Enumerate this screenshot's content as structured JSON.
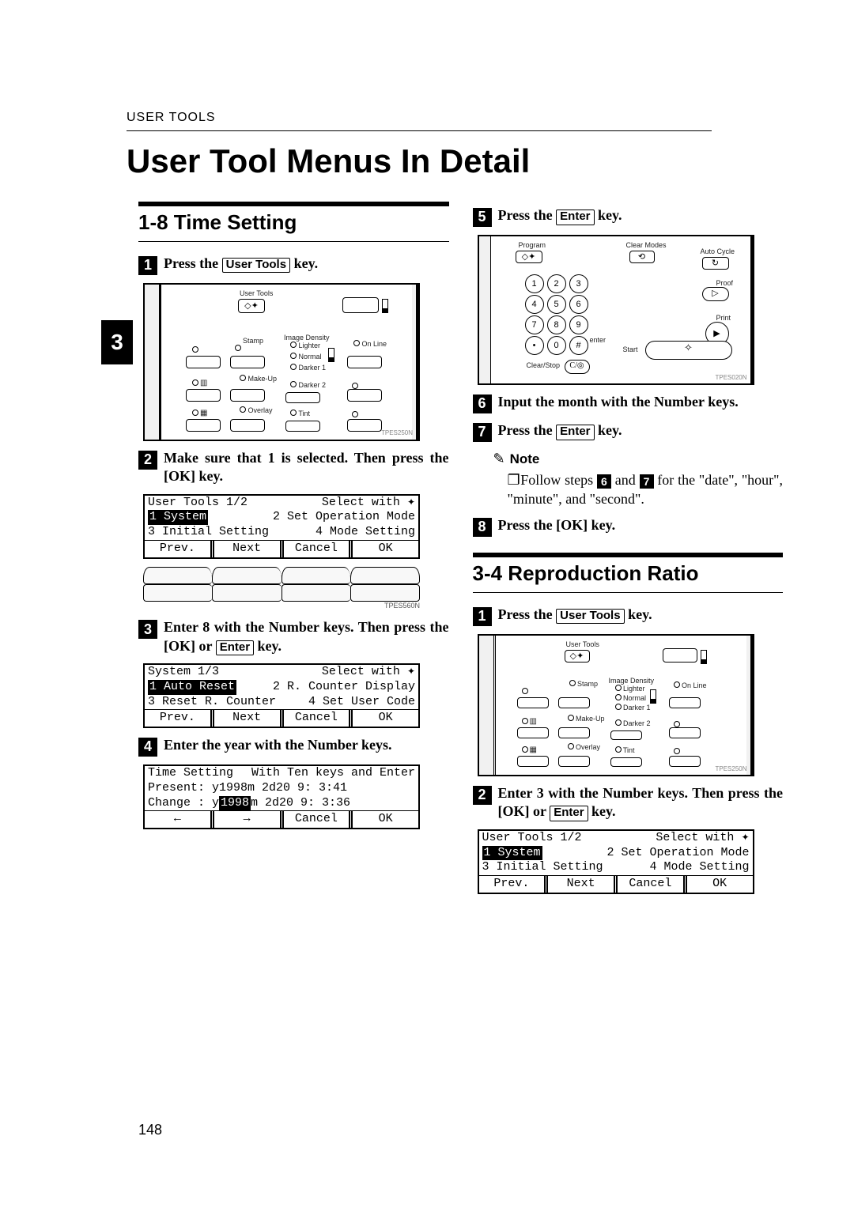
{
  "header": {
    "running_head": "USER TOOLS"
  },
  "page_title": "User Tool Menus In Detail",
  "chapter_tab": "3",
  "page_number": "148",
  "keys": {
    "user_tools": "User Tools",
    "enter": "Enter",
    "ok": "OK"
  },
  "sections": {
    "time_setting": {
      "title": "1-8 Time Setting",
      "steps": {
        "s1": {
          "num": "1",
          "pre": "Press the ",
          "post": " key."
        },
        "s2": {
          "num": "2",
          "text_a": "Make sure that 1 is selected. Then press the [",
          "text_b": "] key."
        },
        "s3": {
          "num": "3",
          "text_a": "Enter 8 with the Number keys. Then press the [",
          "text_b": "] or ",
          "text_c": " key."
        },
        "s4": {
          "num": "4",
          "text": "Enter the year with the Number keys."
        },
        "s5": {
          "num": "5",
          "pre": "Press the ",
          "post": " key."
        },
        "s6": {
          "num": "6",
          "text": "Input the month with the Number keys."
        },
        "s7": {
          "num": "7",
          "pre": "Press the ",
          "post": " key."
        },
        "s8": {
          "num": "8",
          "text_a": "Press the [",
          "text_b": "] key."
        }
      },
      "note": {
        "label": "Note",
        "body_a": "Follow steps ",
        "ref1": "6",
        "body_b": " and ",
        "ref2": "7",
        "body_c": " for the \"date\", \"hour\", \"minute\", and \"second\"."
      }
    },
    "repro_ratio": {
      "title": "3-4 Reproduction Ratio",
      "steps": {
        "s1": {
          "num": "1",
          "pre": "Press the ",
          "post": " key."
        },
        "s2": {
          "num": "2",
          "text_a": "Enter 3 with the Number keys. Then press the [",
          "text_b": "] or ",
          "text_c": " key."
        }
      }
    }
  },
  "lcd": {
    "user_tools": {
      "title": "User Tools 1/2",
      "hint": "Select with",
      "item1": "1 System",
      "item2": "2 Set Operation Mode",
      "item3": "3 Initial Setting",
      "item4": "4 Mode Setting",
      "btns": {
        "prev": "Prev.",
        "next": "Next",
        "cancel": "Cancel",
        "ok": "OK"
      }
    },
    "system": {
      "title": "System 1/3",
      "hint": "Select with",
      "item1": "1 Auto Reset",
      "item2": "2 R. Counter Display",
      "item3": "3 Reset R. Counter",
      "item4": "4 Set User Code",
      "btns": {
        "prev": "Prev.",
        "next": "Next",
        "cancel": "Cancel",
        "ok": "OK"
      }
    },
    "time_setting": {
      "title": "Time Setting",
      "hint": "With Ten keys and Enter",
      "line2": "Present: y1998m 2d20   9: 3:41",
      "line3a": "Change : y",
      "line3hl": "1998",
      "line3b": "m 2d20   9: 3:36",
      "btns": {
        "left": "←",
        "right": "→",
        "cancel": "Cancel",
        "ok": "OK"
      }
    }
  },
  "panel_labels": {
    "user_tools": "User Tools",
    "stamp": "Stamp",
    "makeup": "Make-Up",
    "overlay": "Overlay",
    "image_density": "Image Density",
    "lighter": "Lighter",
    "normal": "Normal",
    "darker1": "Darker 1",
    "darker2": "Darker 2",
    "tint": "Tint",
    "online": "On Line",
    "program": "Program",
    "clear_modes": "Clear Modes",
    "auto_cycle": "Auto Cycle",
    "proof": "Proof",
    "print": "Print",
    "start": "Start",
    "clear_stop": "Clear/Stop",
    "enter": "enter"
  },
  "figure_codes": {
    "a": "TPES250N",
    "b": "TPES560N",
    "c": "TPES020N"
  },
  "softkey_label": "TPES560N"
}
